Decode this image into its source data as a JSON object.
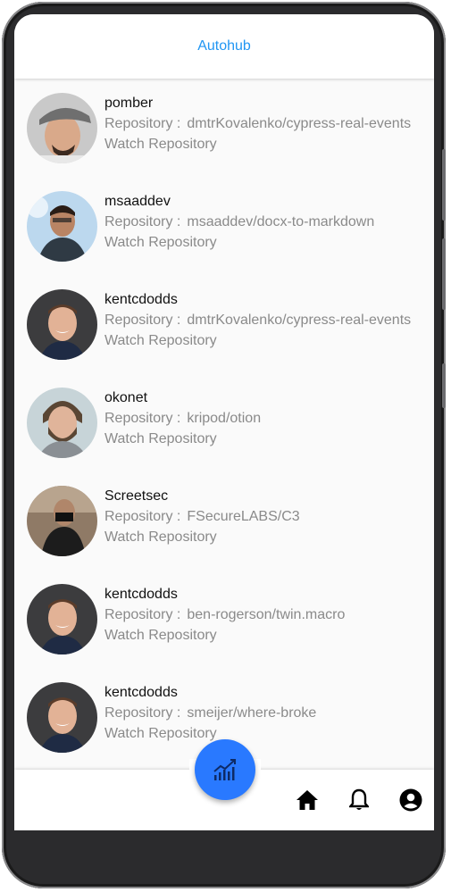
{
  "app": {
    "title": "Autohub",
    "accent_color": "#2196f3",
    "fab_color": "#2979ff"
  },
  "list": {
    "repo_prefix": "Repository :",
    "watch_label": "Watch Repository",
    "items": [
      {
        "user": "pomber",
        "repository": "dmtrKovalenko/cypress-real-events",
        "avatar": "user-avatar-cap"
      },
      {
        "user": "msaaddev",
        "repository": "msaaddev/docx-to-markdown",
        "avatar": "user-avatar-glasses"
      },
      {
        "user": "kentcdodds",
        "repository": "dmtrKovalenko/cypress-real-events",
        "avatar": "user-avatar-smile"
      },
      {
        "user": "okonet",
        "repository": "kripod/otion",
        "avatar": "user-avatar-beard"
      },
      {
        "user": "Screetsec",
        "repository": "FSecureLABS/C3",
        "avatar": "user-avatar-mask"
      },
      {
        "user": "kentcdodds",
        "repository": "ben-rogerson/twin.macro",
        "avatar": "user-avatar-smile"
      },
      {
        "user": "kentcdodds",
        "repository": "smeijer/where-broke",
        "avatar": "user-avatar-smile"
      }
    ]
  },
  "bottom_nav": {
    "fab_icon": "trending-chart-icon",
    "items": [
      {
        "icon": "home-icon"
      },
      {
        "icon": "bell-icon"
      },
      {
        "icon": "account-circle-icon"
      }
    ]
  }
}
